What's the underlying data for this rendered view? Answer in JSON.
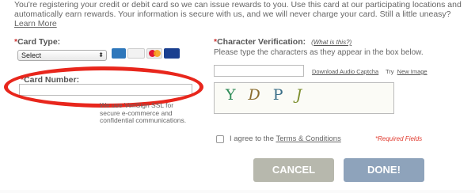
{
  "intro": {
    "text": "You're registering your credit or debit card so we can issue rewards to you. Use this card at our participating locations and automatically earn rewards. Your information is secure with us, and we will never charge your card. Still a little uneasy?",
    "learn_more": "Learn More"
  },
  "card_type": {
    "star": "*",
    "label": "Card Type:",
    "selected": "Select",
    "accepted_cards": [
      "amex-icon",
      "discover-icon",
      "mastercard-icon",
      "visa-icon"
    ]
  },
  "card_number": {
    "star": "*",
    "label": "Card Number:",
    "value": "",
    "ssl_note": "We use VeriSign SSL for secure e-commerce and confidential communications."
  },
  "character_verification": {
    "star": "*",
    "label": "Character Verification:",
    "what_is_this": "(What is this?)",
    "instruction": "Please type the characters as they appear in the box below.",
    "value": "",
    "download_audio": "Download Audio Captcha",
    "try_text": "Try",
    "new_image": "New Image",
    "captcha_chars": [
      "Y",
      "D",
      "P",
      "J"
    ]
  },
  "agreement": {
    "text": "I agree to the",
    "link": "Terms & Conditions",
    "required_note": "*Required Fields"
  },
  "buttons": {
    "cancel": "CANCEL",
    "done": "DONE!"
  },
  "colors": {
    "highlight_ellipse": "#e8261c",
    "cancel_button": "#b7b8ad",
    "done_button": "#8ea3bb",
    "required_text": "#e03a2e"
  }
}
